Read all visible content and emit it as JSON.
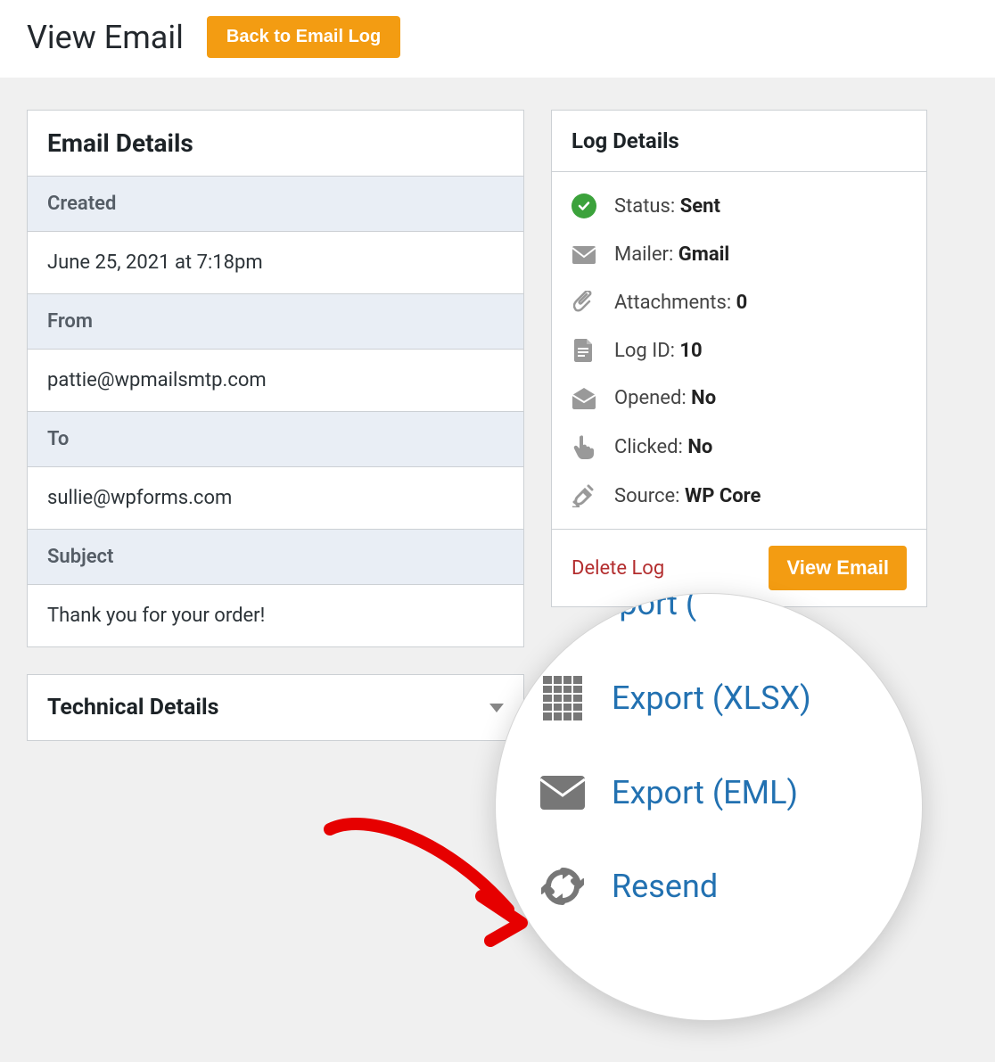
{
  "header": {
    "title": "View Email",
    "back_label": "Back to Email Log"
  },
  "email_details": {
    "title": "Email Details",
    "created_label": "Created",
    "created_value": "June 25, 2021 at 7:18pm",
    "from_label": "From",
    "from_value": "pattie@wpmailsmtp.com",
    "to_label": "To",
    "to_value": "sullie@wpforms.com",
    "subject_label": "Subject",
    "subject_value": "Thank you for your order!"
  },
  "technical": {
    "title": "Technical Details"
  },
  "log_details": {
    "title": "Log Details",
    "status_label": "Status: ",
    "status_value": "Sent",
    "mailer_label": "Mailer: ",
    "mailer_value": "Gmail",
    "attachments_label": "Attachments: ",
    "attachments_value": "0",
    "logid_label": "Log ID: ",
    "logid_value": "10",
    "opened_label": "Opened: ",
    "opened_value": "No",
    "clicked_label": "Clicked: ",
    "clicked_value": "No",
    "source_label": "Source: ",
    "source_value": "WP Core",
    "delete_label": "Delete Log",
    "view_label": "View Email"
  },
  "zoom": {
    "export_top": "Export (",
    "xlsx": "Export (XLSX)",
    "eml": "Export (EML)",
    "resend": "Resend"
  }
}
